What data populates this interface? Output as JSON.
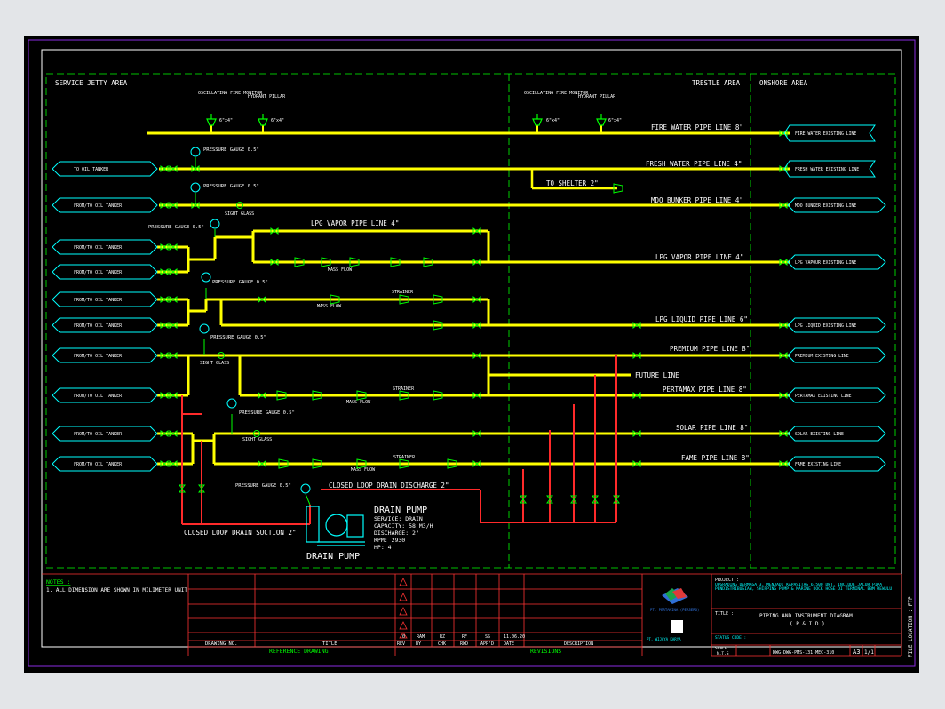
{
  "areas": {
    "service_jetty": "SERVICE JETTY AREA",
    "trestle": "TRESTLE AREA",
    "onshore": "ONSHORE AREA"
  },
  "equipment": {
    "oscillating_monitor": "OSCILLATING FIRE MONITOR",
    "hydrant_pillar": "HYDRANT PILLAR",
    "size_6x4": "6\"x4\"",
    "pressure_gauge_05": "PRESSURE GAUGE 0.5\"",
    "sight_glass": "SIGHT GLASS",
    "mass_flow": "MASS FLOW",
    "strainer": "STRAINER",
    "future_line": "FUTURE LINE"
  },
  "lines": {
    "fire_water": "FIRE WATER PIPE LINE 8\"",
    "fresh_water": "FRESH WATER PIPE LINE 4\"",
    "to_shelter": "TO SHELTER 2\"",
    "mdo_bunker": "MDO BUNKER PIPE LINE 4\"",
    "lpg_vapor_top": "LPG VAPOR PIPE LINE 4\"",
    "lpg_vapor": "LPG VAPOR PIPE LINE 4\"",
    "lpg_liquid": "LPG LIQUID PIPE LINE 6\"",
    "premium": "PREMIUM PIPE LINE 8\"",
    "pertamax": "PERTAMAX PIPE LINE 8\"",
    "solar": "SOLAR PIPE LINE 8\"",
    "fame": "FAME PIPE LINE 8\"",
    "closed_loop_discharge": "CLOSED LOOP DRAIN DISCHARGE 2\"",
    "closed_loop_suction": "CLOSED LOOP DRAIN SUCTION 2\""
  },
  "left_connectors": [
    "TO OIL TANKER",
    "FROM/TO OIL TANKER",
    "FROM/TO OIL TANKER",
    "FROM/TO OIL TANKER",
    "FROM/TO OIL TANKER",
    "FROM/TO OIL TANKER",
    "FROM/TO OIL TANKER",
    "FROM/TO OIL TANKER",
    "FROM/TO OIL TANKER",
    "FROM/TO OIL TANKER"
  ],
  "right_connectors": [
    "FIRE WATER EXISTING LINE",
    "FRESH WATER EXISTING LINE",
    "MDO BUNKER EXISTING LINE",
    "LPG VAPOUR EXISTING LINE",
    "LPG LIQUID EXISTING LINE",
    "PREMIUM EXISTING LINE",
    "PERTAMAX EXISTING LINE",
    "SOLAR EXISTING LINE",
    "FAME EXISTING LINE"
  ],
  "pump": {
    "title": "DRAIN PUMP",
    "specs": [
      "SERVICE: DRAIN",
      "CAPACITY: 58 M3/H",
      "DISCHARGE: 2\"",
      "RPM: 2930",
      "HP: 4"
    ],
    "label": "DRAIN PUMP"
  },
  "notes": {
    "heading": "NOTES :",
    "items": [
      "1. ALL DIMENSION ARE SHOWN IN MILIMETER UNIT"
    ]
  },
  "title_block": {
    "ref_headers": [
      "DRAWING NO.",
      "TITLE"
    ],
    "ref_footer": "REFERENCE DRAWING",
    "rev_row": [
      "0",
      "RAM",
      "RZ",
      "RF",
      "SS",
      "11.06.20"
    ],
    "rev_headers": [
      "REV",
      "BY",
      "CHK",
      "RWD",
      "APP'D",
      "DATE",
      "DESCRIPTION"
    ],
    "rev_footer": "REVISIONS",
    "project_label": "PROJECT :",
    "project_text": "UPGRADING DERMAGA 3, MENJADI KAPASITAS 6.500 DWT, INCLUDE JALUR PIPA PENDISTRIBUSIAN, SHIPPING PUMP & MARINE DOCK HOSE DI TERMINAL BBM REWULU",
    "title_label": "TITLE :",
    "title_line1": "PIPING AND INSTRUMENT DIAGRAM",
    "title_line2": "( P & I D )",
    "company": "PT. PERTAMINA (PERSERO)",
    "company2": "PT. WIJAYA KARYA",
    "code_label": "STATUS CODE :",
    "scale_label": "SCALE",
    "scale": "N.T.S",
    "dwg_no": "DWG-DWG-PMS-131-MEC-310",
    "size": "A3",
    "sheet": "1/1",
    "side_text": "FILE LOCATION : FTP"
  },
  "colors": {
    "pipe": "#ffff00",
    "drain": "#ff2a2a",
    "component": "#00ff00",
    "label": "#ffffff",
    "connector": "#00ffff",
    "frame": "#00ff00"
  }
}
